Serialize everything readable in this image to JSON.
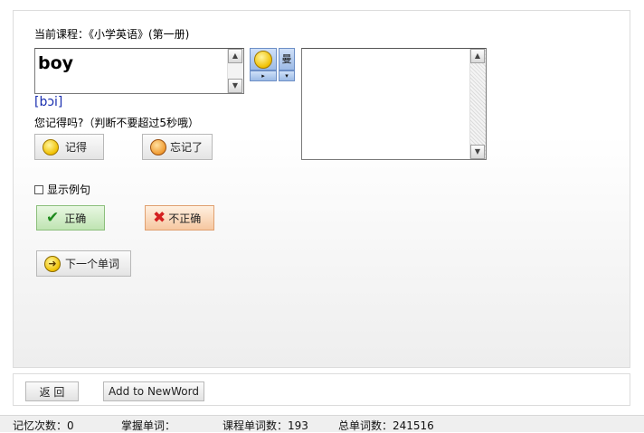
{
  "course": {
    "label": "当前课程：《小学英语》(第一册)"
  },
  "word": {
    "text": "boy",
    "phonetic": "[bɔi]"
  },
  "tools": {
    "play": "▸",
    "dropdown": "▾",
    "voice": "曼"
  },
  "question": "您记得吗?（判断不要超过5秒哦）",
  "buttons": {
    "remember": "记得",
    "forgot": "忘记了",
    "correct": "正确",
    "incorrect": "不正确",
    "next_word": "下一个单词",
    "back": "返 回",
    "add_new_word": "Add to NewWord"
  },
  "show_example": {
    "label": "显示例句",
    "checked": false
  },
  "icons": {
    "remember": "smile-icon",
    "forgot": "worried-face-icon",
    "correct": "checkmark-icon",
    "incorrect": "cross-icon",
    "next": "arrow-right-icon"
  },
  "status": {
    "memory_count": "记忆次数：0",
    "mastered": "掌握单词：",
    "course_words": "课程单词数：193",
    "total_words": "总单词数：241516"
  },
  "colors": {
    "phonetic": "#1a2fb0",
    "correct_bg": "#bfe4b2",
    "incorrect_bg": "#f6c7a0"
  }
}
